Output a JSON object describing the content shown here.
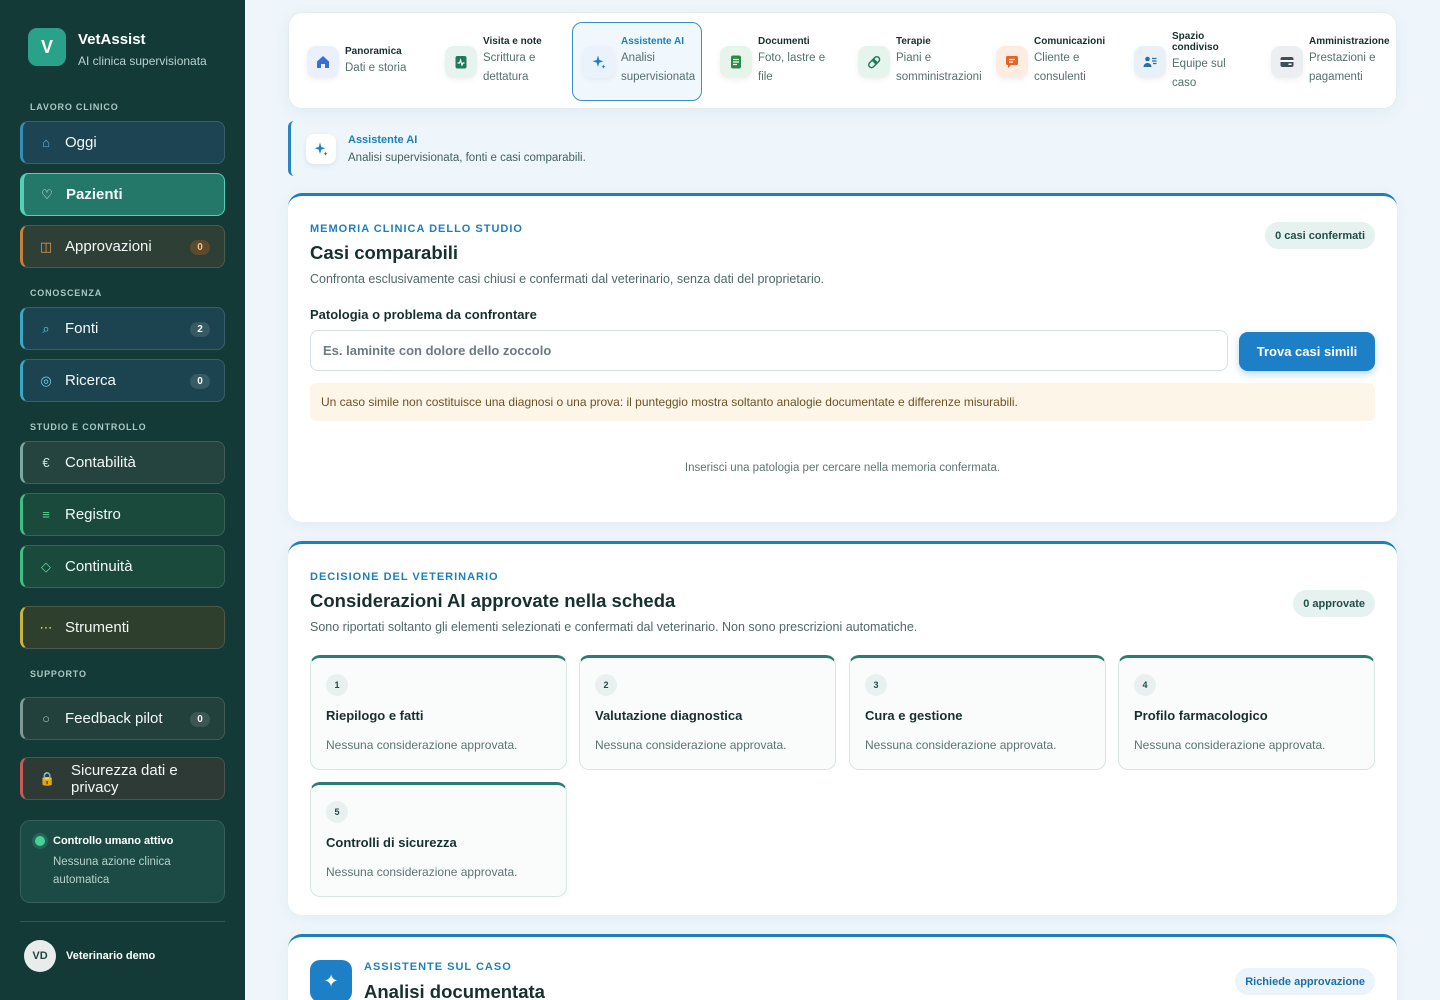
{
  "brand": {
    "logo_letter": "V",
    "name": "VetAssist",
    "subtitle": "AI clinica supervisionata"
  },
  "sidebar": {
    "sections": {
      "clinical": "LAVORO CLINICO",
      "knowledge": "CONOSCENZA",
      "studio": "STUDIO E CONTROLLO",
      "support": "SUPPORTO"
    },
    "items": [
      {
        "label": "Oggi"
      },
      {
        "label": "Pazienti"
      },
      {
        "label": "Approvazioni",
        "badge": "0"
      },
      {
        "label": "Fonti",
        "badge": "2"
      },
      {
        "label": "Ricerca",
        "badge": "0"
      },
      {
        "label": "Contabilità"
      },
      {
        "label": "Registro"
      },
      {
        "label": "Continuità"
      },
      {
        "label": "Strumenti"
      },
      {
        "label": "Feedback pilot",
        "badge": "0"
      },
      {
        "label": "Sicurezza dati e privacy"
      }
    ],
    "control": {
      "title": "Controllo umano attivo",
      "text": "Nessuna azione clinica automatica"
    },
    "user": {
      "initials": "VD",
      "name": "Veterinario demo"
    }
  },
  "tabs": [
    {
      "title": "Panoramica",
      "sub": "Dati e storia",
      "icon": "home-icon"
    },
    {
      "title": "Visita e note",
      "sub": "Scrittura e dettatura",
      "icon": "clipboard-icon"
    },
    {
      "title": "Assistente AI",
      "sub": "Analisi supervisionata",
      "icon": "sparkle-icon"
    },
    {
      "title": "Documenti",
      "sub": "Foto, lastre e file",
      "icon": "document-icon"
    },
    {
      "title": "Terapie",
      "sub": "Piani e somministrazioni",
      "icon": "pill-icon"
    },
    {
      "title": "Comunicazioni",
      "sub": "Cliente e consulenti",
      "icon": "chat-icon"
    },
    {
      "title": "Spazio condiviso",
      "sub": "Equipe sul caso",
      "icon": "team-icon"
    },
    {
      "title": "Amministrazione",
      "sub": "Prestazioni e pagamenti",
      "icon": "wallet-icon"
    }
  ],
  "section": {
    "title": "Assistente AI",
    "subtitle": "Analisi supervisionata, fonti e casi comparabili."
  },
  "comparable": {
    "eyebrow": "MEMORIA CLINICA DELLO STUDIO",
    "title": "Casi comparabili",
    "description": "Confronta esclusivamente casi chiusi e confermati dal veterinario, senza dati del proprietario.",
    "pill": "0 casi confermati",
    "field_label": "Patologia o problema da confrontare",
    "placeholder": "Es. laminite con dolore dello zoccolo",
    "button": "Trova casi simili",
    "warning": "Un caso simile non costituisce una diagnosi o una prova: il punteggio mostra soltanto analogie documentate e differenze misurabili.",
    "empty": "Inserisci una patologia per cercare nella memoria confermata."
  },
  "decision": {
    "eyebrow": "DECISIONE DEL VETERINARIO",
    "title": "Considerazioni AI approvate nella scheda",
    "description": "Sono riportati soltanto gli elementi selezionati e confermati dal veterinario. Non sono prescrizioni automatiche.",
    "pill": "0 approvate",
    "cards": [
      {
        "num": "1",
        "title": "Riepilogo e fatti",
        "text": "Nessuna considerazione approvata."
      },
      {
        "num": "2",
        "title": "Valutazione diagnostica",
        "text": "Nessuna considerazione approvata."
      },
      {
        "num": "3",
        "title": "Cura e gestione",
        "text": "Nessuna considerazione approvata."
      },
      {
        "num": "4",
        "title": "Profilo farmacologico",
        "text": "Nessuna considerazione approvata."
      },
      {
        "num": "5",
        "title": "Controlli di sicurezza",
        "text": "Nessuna considerazione approvata."
      }
    ]
  },
  "assistant": {
    "eyebrow": "ASSISTENTE SUL CASO",
    "title": "Analisi documentata",
    "pill": "Richiede approvazione"
  }
}
